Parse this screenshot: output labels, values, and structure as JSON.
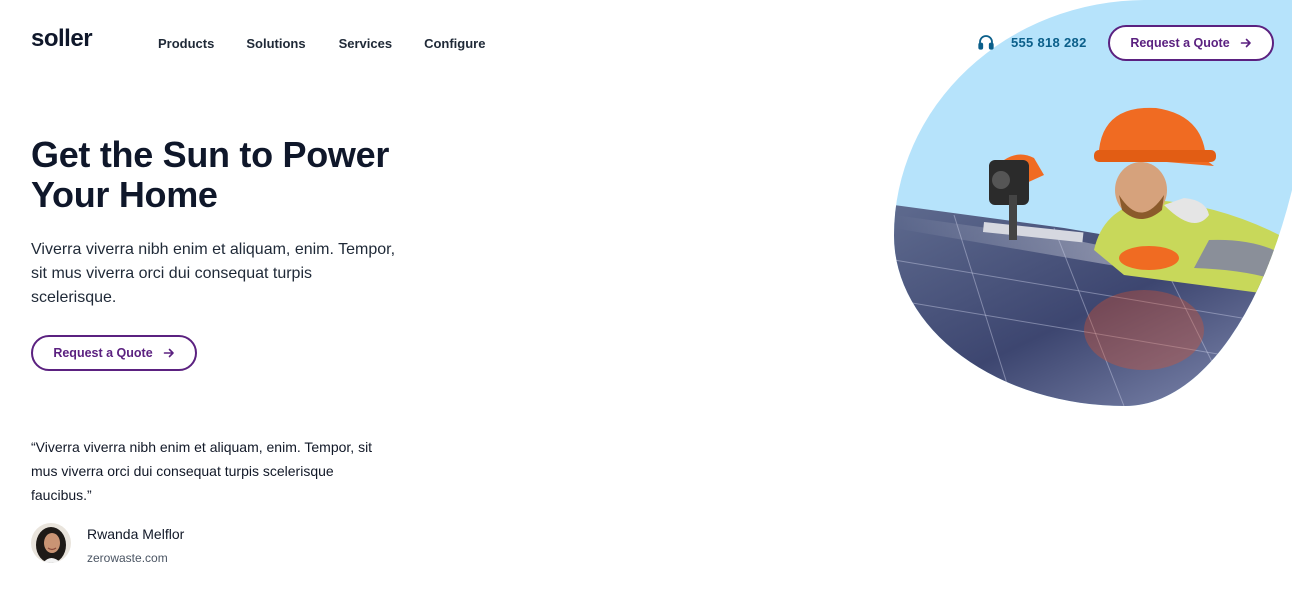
{
  "header": {
    "logo": "soller",
    "nav": [
      "Products",
      "Solutions",
      "Services",
      "Configure"
    ],
    "phone": "555 818 282",
    "cta_label": "Request a Quote"
  },
  "hero": {
    "title": "Get the Sun to Power Your Home",
    "lead": "Viverra viverra nibh enim et aliquam, enim. Tempor, sit mus viverra orci dui consequat turpis scelerisque.",
    "cta_label": "Request a Quote",
    "image_alt": "Worker in orange hard hat installing solar panels"
  },
  "testimonial": {
    "quote": "“Viverra viverra nibh enim et aliquam, enim. Tempor, sit mus viverra orci dui consequat turpis scelerisque faucibus.”",
    "author": "Rwanda Melflor",
    "site": "zerowaste.com"
  },
  "colors": {
    "accent": "#5b2180",
    "phone": "#0b5f8a",
    "sky": "#b6e3fb",
    "helmet": "#f06b22"
  },
  "icons": {
    "phone": "headphones-icon",
    "arrow": "arrow-right-icon"
  }
}
